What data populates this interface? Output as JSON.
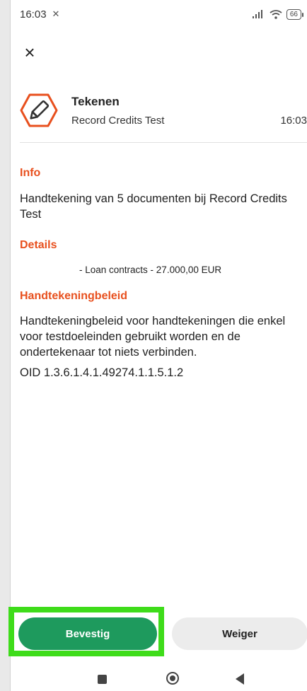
{
  "status": {
    "time": "16:03",
    "alarm": "⏰",
    "signal": ".ıll",
    "wifi": "wifi",
    "battery": "66"
  },
  "close": {
    "icon": "×"
  },
  "header": {
    "title": "Tekenen",
    "subtitle": "Record Credits Test",
    "time": "16:03"
  },
  "sections": {
    "info": {
      "title": "Info",
      "text": "Handtekening van 5 documenten bij Record Credits Test"
    },
    "details": {
      "title": "Details",
      "line": "- Loan contracts - 27.000,00 EUR"
    },
    "policy": {
      "title": "Handtekeningbeleid",
      "text": "Handtekeningbeleid voor handtekeningen die enkel voor testdoeleinden gebruikt worden en de ondertekenaar tot niets verbinden.",
      "oid": "OID 1.3.6.1.4.1.49274.1.1.5.1.2"
    }
  },
  "buttons": {
    "confirm": "Bevestig",
    "refuse": "Weiger"
  },
  "colors": {
    "accent": "#e8501e",
    "confirm": "#1e9a5d",
    "highlight": "#3edc1a"
  }
}
